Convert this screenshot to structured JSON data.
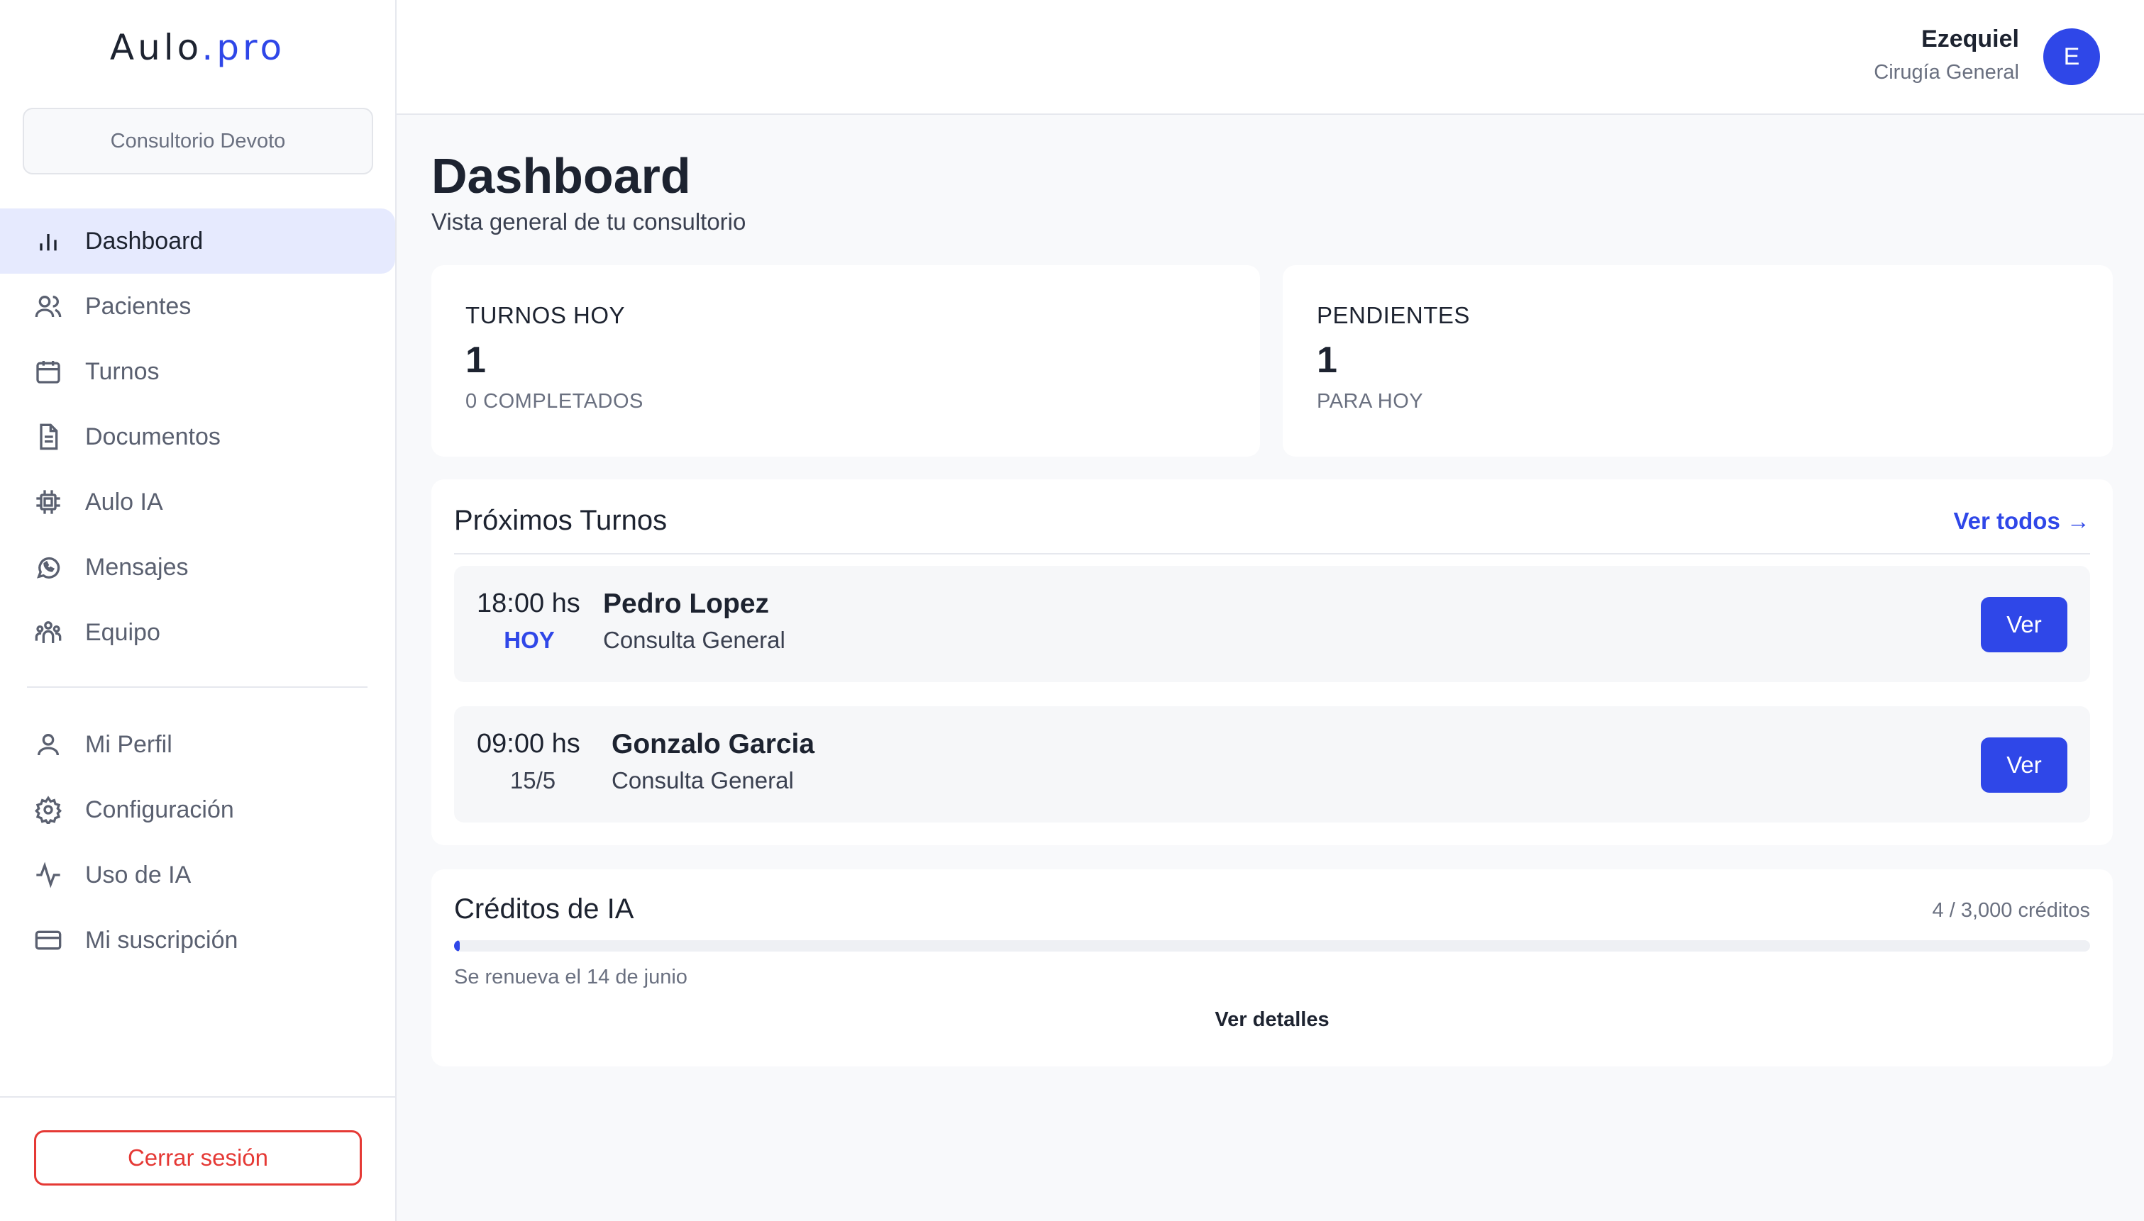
{
  "brand": {
    "part1": "Aulo",
    "dot": ".",
    "part2": "pro"
  },
  "sidebar": {
    "clinic": "Consultorio Devoto",
    "items": [
      {
        "label": "Dashboard",
        "icon": "bar-chart-icon"
      },
      {
        "label": "Pacientes",
        "icon": "users-icon"
      },
      {
        "label": "Turnos",
        "icon": "calendar-icon"
      },
      {
        "label": "Documentos",
        "icon": "document-icon"
      },
      {
        "label": "Aulo IA",
        "icon": "chip-icon"
      },
      {
        "label": "Mensajes",
        "icon": "whatsapp-icon"
      },
      {
        "label": "Equipo",
        "icon": "team-icon"
      }
    ],
    "secondary": [
      {
        "label": "Mi Perfil",
        "icon": "user-icon"
      },
      {
        "label": "Configuración",
        "icon": "gear-icon"
      },
      {
        "label": "Uso de IA",
        "icon": "activity-icon"
      },
      {
        "label": "Mi suscripción",
        "icon": "credit-card-icon"
      }
    ],
    "logout": "Cerrar sesión"
  },
  "header": {
    "user_name": "Ezequiel",
    "user_role": "Cirugía General",
    "avatar_initial": "E"
  },
  "main": {
    "title": "Dashboard",
    "subtitle": "Vista general de tu consultorio",
    "stats": [
      {
        "label": "TURNOS HOY",
        "value": "1",
        "sub": "0 COMPLETADOS"
      },
      {
        "label": "PENDIENTES",
        "value": "1",
        "sub": "PARA HOY"
      }
    ],
    "upcoming": {
      "title": "Próximos Turnos",
      "view_all": "Ver todos →",
      "appointments": [
        {
          "time": "18:00 hs",
          "when": "HOY",
          "patient": "Pedro Lopez",
          "type": "Consulta General",
          "button": "Ver"
        },
        {
          "time": "09:00 hs",
          "when": "15/5",
          "patient": "Gonzalo Garcia",
          "type": "Consulta General",
          "button": "Ver"
        }
      ]
    },
    "credits": {
      "title": "Créditos de IA",
      "usage": "4 / 3,000 créditos",
      "used_fraction": 0.00133,
      "renew": "Se renueva el 14 de junio",
      "details": "Ver detalles"
    }
  },
  "colors": {
    "accent": "#2f47e8",
    "danger": "#e53935",
    "active_bg": "#e6eafe"
  }
}
